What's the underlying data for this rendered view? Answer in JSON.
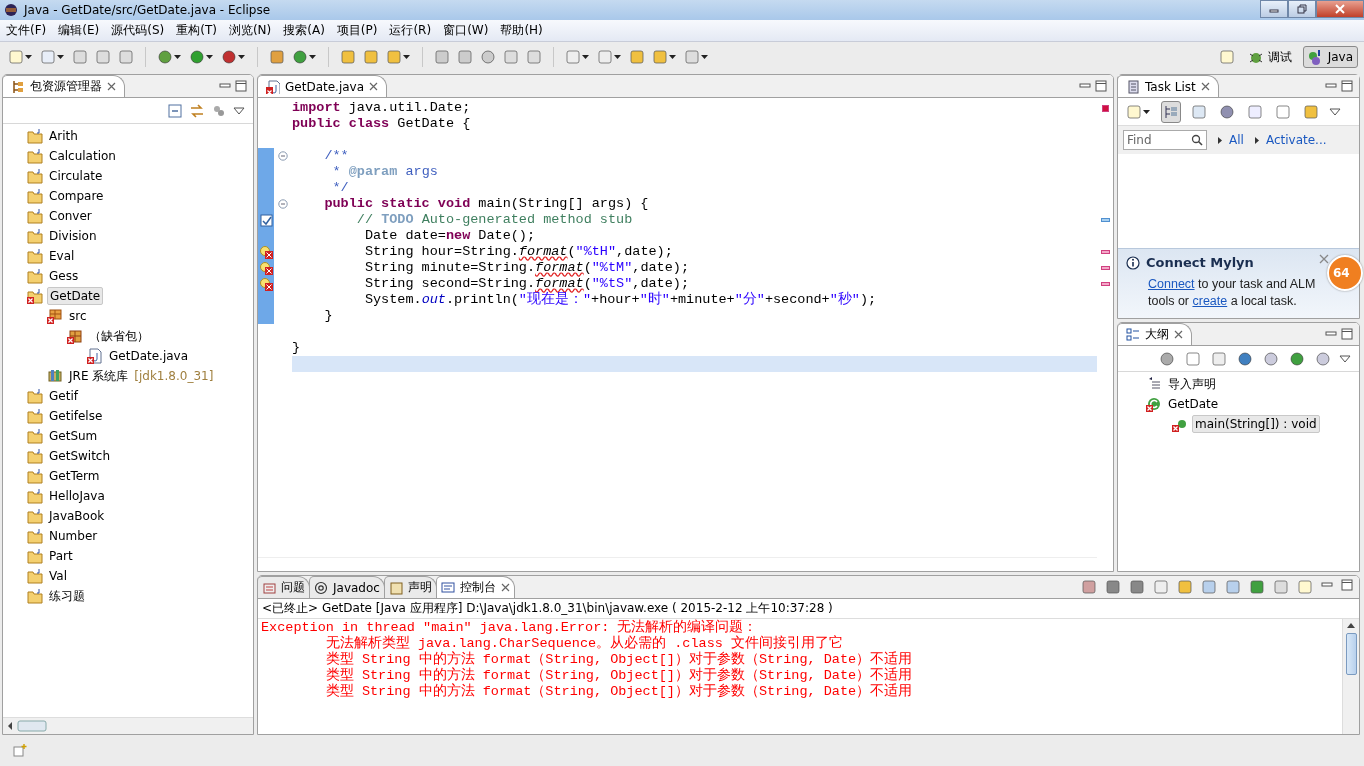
{
  "window": {
    "title": "Java  -  GetDate/src/GetDate.java  -  Eclipse"
  },
  "menu": [
    "文件(F)",
    "编辑(E)",
    "源代码(S)",
    "重构(T)",
    "浏览(N)",
    "搜索(A)",
    "项目(P)",
    "运行(R)",
    "窗口(W)",
    "帮助(H)"
  ],
  "perspectives": [
    {
      "label": "调试",
      "selected": false
    },
    {
      "label": "Java",
      "selected": true
    }
  ],
  "package_explorer": {
    "title": "包资源管理器",
    "items": [
      {
        "label": "Arith",
        "kind": "project",
        "error": false,
        "selected": false
      },
      {
        "label": "Calculation",
        "kind": "project",
        "error": false,
        "selected": false
      },
      {
        "label": "Circulate",
        "kind": "project",
        "error": false,
        "selected": false
      },
      {
        "label": "Compare",
        "kind": "project",
        "error": false,
        "selected": false
      },
      {
        "label": "Conver",
        "kind": "project",
        "error": false,
        "selected": false
      },
      {
        "label": "Division",
        "kind": "project",
        "error": false,
        "selected": false
      },
      {
        "label": "Eval",
        "kind": "project",
        "error": false,
        "selected": false
      },
      {
        "label": "Gess",
        "kind": "project",
        "error": false,
        "selected": false
      },
      {
        "label": "GetDate",
        "kind": "project",
        "error": true,
        "selected": true,
        "children": [
          {
            "label": "src",
            "kind": "source",
            "error": true,
            "selected": false,
            "children": [
              {
                "label": "（缺省包）",
                "kind": "package",
                "error": true,
                "selected": false,
                "children": [
                  {
                    "label": "GetDate.java",
                    "kind": "file",
                    "error": true,
                    "selected": false
                  }
                ]
              }
            ]
          },
          {
            "label": "JRE 系统库",
            "decoration": "[jdk1.8.0_31]",
            "kind": "library",
            "error": false,
            "selected": false
          }
        ]
      },
      {
        "label": "Getif",
        "kind": "project",
        "error": false,
        "selected": false
      },
      {
        "label": "Getifelse",
        "kind": "project",
        "error": false,
        "selected": false
      },
      {
        "label": "GetSum",
        "kind": "project",
        "error": false,
        "selected": false
      },
      {
        "label": "GetSwitch",
        "kind": "project",
        "error": false,
        "selected": false
      },
      {
        "label": "GetTerm",
        "kind": "project",
        "error": false,
        "selected": false
      },
      {
        "label": "HelloJava",
        "kind": "project",
        "error": false,
        "selected": false
      },
      {
        "label": "JavaBook",
        "kind": "project",
        "error": false,
        "selected": false
      },
      {
        "label": "Number",
        "kind": "project",
        "error": false,
        "selected": false
      },
      {
        "label": "Part",
        "kind": "project",
        "error": false,
        "selected": false
      },
      {
        "label": "Val",
        "kind": "project",
        "error": false,
        "selected": false
      },
      {
        "label": "练习题",
        "kind": "project",
        "error": false,
        "selected": false
      }
    ]
  },
  "editor": {
    "tab": "GetDate.java",
    "lines": [
      {
        "kind": "code",
        "in_range": false,
        "current": false,
        "tokens": [
          {
            "kind": "keyword",
            "text": "import"
          },
          {
            "kind": "plain",
            "text": " java.util.Date;"
          }
        ]
      },
      {
        "kind": "code",
        "in_range": false,
        "current": false,
        "tokens": [
          {
            "kind": "keyword",
            "text": "public class"
          },
          {
            "kind": "plain",
            "text": " GetDate {"
          }
        ]
      },
      {
        "kind": "code",
        "in_range": false,
        "current": false
      },
      {
        "kind": "fold",
        "in_range": true,
        "current": false,
        "tokens": [
          {
            "kind": "javadoc",
            "text": "    /**"
          }
        ]
      },
      {
        "kind": "code",
        "in_range": true,
        "current": false,
        "tokens": [
          {
            "kind": "javadoc",
            "text": "     * "
          },
          {
            "kind": "doctag",
            "text": "@param"
          },
          {
            "kind": "javadoc",
            "text": " args"
          }
        ]
      },
      {
        "kind": "code",
        "in_range": true,
        "current": false,
        "tokens": [
          {
            "kind": "javadoc",
            "text": "     */"
          }
        ]
      },
      {
        "kind": "fold",
        "in_range": true,
        "current": false,
        "tokens": [
          {
            "kind": "keyword",
            "text": "    public static void"
          },
          {
            "kind": "plain",
            "text": " main(String[] args) {"
          }
        ]
      },
      {
        "kind": "task",
        "in_range": true,
        "current": false,
        "tokens": [
          {
            "kind": "comment",
            "text": "        // "
          },
          {
            "kind": "todo",
            "text": "TODO"
          },
          {
            "kind": "comment",
            "text": " Auto-generated method stub"
          }
        ]
      },
      {
        "kind": "code",
        "in_range": true,
        "current": false,
        "tokens": [
          {
            "kind": "plain",
            "text": "         Date date="
          },
          {
            "kind": "keyword",
            "text": "new"
          },
          {
            "kind": "plain",
            "text": " Date();"
          }
        ]
      },
      {
        "kind": "error",
        "in_range": true,
        "current": false,
        "tokens": [
          {
            "kind": "plain",
            "text": "         String hour=String."
          },
          {
            "kind": "error",
            "text": "format"
          },
          {
            "kind": "plain",
            "text": "("
          },
          {
            "kind": "string",
            "text": "\"%tH\""
          },
          {
            "kind": "plain",
            "text": ",date);"
          }
        ]
      },
      {
        "kind": "error",
        "in_range": true,
        "current": false,
        "tokens": [
          {
            "kind": "plain",
            "text": "         String minute=String."
          },
          {
            "kind": "error",
            "text": "format"
          },
          {
            "kind": "plain",
            "text": "("
          },
          {
            "kind": "string",
            "text": "\"%tM\""
          },
          {
            "kind": "plain",
            "text": ",date);"
          }
        ]
      },
      {
        "kind": "error",
        "in_range": true,
        "current": false,
        "tokens": [
          {
            "kind": "plain",
            "text": "         String second=String."
          },
          {
            "kind": "error",
            "text": "format"
          },
          {
            "kind": "plain",
            "text": "("
          },
          {
            "kind": "string",
            "text": "\"%tS\""
          },
          {
            "kind": "plain",
            "text": ",date);"
          }
        ]
      },
      {
        "kind": "code",
        "in_range": true,
        "current": false,
        "tokens": [
          {
            "kind": "plain",
            "text": "         System."
          },
          {
            "kind": "field",
            "text": "out"
          },
          {
            "kind": "plain",
            "text": ".println("
          },
          {
            "kind": "string",
            "text": "\"现在是：\""
          },
          {
            "kind": "plain",
            "text": "+hour+"
          },
          {
            "kind": "string",
            "text": "\"时\""
          },
          {
            "kind": "plain",
            "text": "+minute+"
          },
          {
            "kind": "string",
            "text": "\"分\""
          },
          {
            "kind": "plain",
            "text": "+second+"
          },
          {
            "kind": "string",
            "text": "\"秒\""
          },
          {
            "kind": "plain",
            "text": ");"
          }
        ]
      },
      {
        "kind": "code",
        "in_range": true,
        "current": false,
        "tokens": [
          {
            "kind": "plain",
            "text": "    }"
          }
        ]
      },
      {
        "kind": "code",
        "in_range": false,
        "current": false
      },
      {
        "kind": "code",
        "in_range": false,
        "current": false,
        "tokens": [
          {
            "kind": "plain",
            "text": "}"
          }
        ]
      },
      {
        "kind": "code",
        "in_range": false,
        "current": true
      }
    ]
  },
  "task_list": {
    "title": "Task List",
    "find_placeholder": "Find",
    "filters": [
      "All",
      "Activate..."
    ],
    "connect": {
      "title": "Connect Mylyn",
      "parts": [
        {
          "text": "Connect",
          "link": true
        },
        {
          "text": " to your task and ALM tools or ",
          "link": false
        },
        {
          "text": "create",
          "link": true
        },
        {
          "text": " a local task.",
          "link": false
        }
      ]
    },
    "badge": "64"
  },
  "outline": {
    "title": "大纲",
    "items": [
      {
        "label": "导入声明",
        "kind": "imports",
        "selected": false
      },
      {
        "label": "GetDate",
        "kind": "class",
        "selected": false,
        "children": [
          {
            "label": "main(String[]) : void",
            "kind": "method",
            "selected": true
          }
        ]
      }
    ]
  },
  "console": {
    "tabs": [
      {
        "label": "问题",
        "selected": false
      },
      {
        "label": "Javadoc",
        "selected": false
      },
      {
        "label": "声明",
        "selected": false
      },
      {
        "label": "控制台",
        "selected": true
      }
    ],
    "header": "<已终止> GetDate [Java 应用程序] D:\\Java\\jdk1.8.0_31\\bin\\javaw.exe ( 2015-2-12 上午10:37:28 )",
    "lines": [
      "Exception in thread \"main\" java.lang.Error: 无法解析的编译问题：",
      "        无法解析类型 java.lang.CharSequence。从必需的 .class 文件间接引用了它",
      "        类型 String 中的方法 format（String, Object[]）对于参数（String, Date）不适用",
      "        类型 String 中的方法 format（String, Object[]）对于参数（String, Date）不适用",
      "        类型 String 中的方法 format（String, Object[]）对于参数（String, Date）不适用"
    ]
  }
}
